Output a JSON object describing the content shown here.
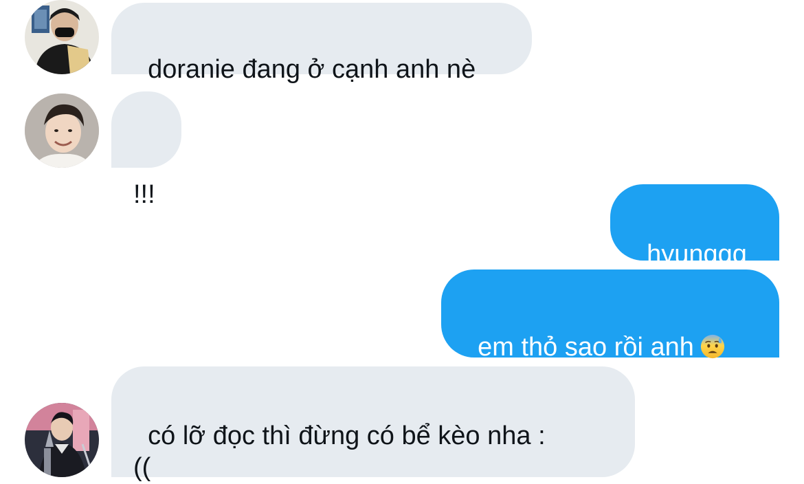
{
  "conversation": {
    "messages": [
      {
        "direction": "incoming",
        "text": "doranie đang ở cạnh anh nè"
      },
      {
        "direction": "incoming",
        "text": "!!!"
      },
      {
        "direction": "outgoing",
        "text": "hyunggg"
      },
      {
        "direction": "outgoing",
        "text": "em thỏ sao rồi anh",
        "emoji": "anxious-face-with-sweat"
      },
      {
        "direction": "incoming",
        "text": "có lỡ đọc thì đừng có bể kèo nha :\n(("
      }
    ]
  },
  "colors": {
    "incoming_bubble": "#e6ebf0",
    "incoming_text": "#0f1419",
    "outgoing_bubble": "#1da1f2",
    "outgoing_text": "#ffffff"
  }
}
